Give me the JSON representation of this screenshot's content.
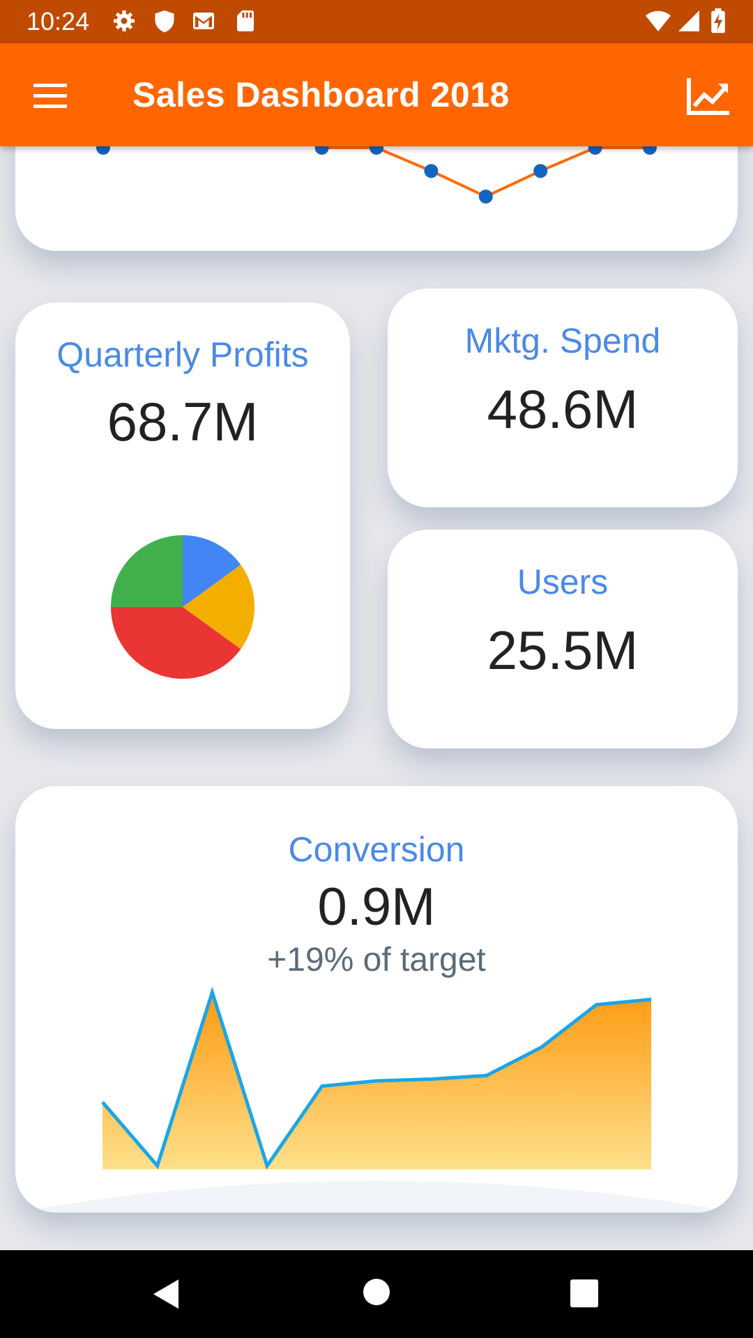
{
  "status_bar": {
    "time": "10:24",
    "left_icons": [
      "settings-icon",
      "shield-icon",
      "gmail-icon",
      "sd-card-icon"
    ],
    "right_icons": [
      "wifi-icon",
      "signal-icon",
      "battery-charging-icon"
    ]
  },
  "app_bar": {
    "title": "Sales Dashboard 2018",
    "menu_icon": "menu-icon",
    "action_icon": "trending-up-icon",
    "color": "#ff6600"
  },
  "top_chart": {
    "type": "line",
    "line_color": "#ff6a00",
    "point_color": "#1565c0",
    "visible_points": [
      {
        "i": 0,
        "v": 100
      },
      {
        "i": 4,
        "v": 100
      },
      {
        "i": 5,
        "v": 100
      },
      {
        "i": 6,
        "v": 80
      },
      {
        "i": 7,
        "v": 58
      },
      {
        "i": 8,
        "v": 80
      },
      {
        "i": 9,
        "v": 100
      },
      {
        "i": 10,
        "v": 100
      }
    ]
  },
  "cards": {
    "profits": {
      "title": "Quarterly Profits",
      "value": "68.7M"
    },
    "mktg": {
      "title": "Mktg. Spend",
      "value": "48.6M"
    },
    "users": {
      "title": "Users",
      "value": "25.5M"
    },
    "conversion": {
      "title": "Conversion",
      "value": "0.9M",
      "subtitle": "+19% of target"
    }
  },
  "chart_data": [
    {
      "type": "pie",
      "slices": [
        {
          "value": 15,
          "color": "#4285f4"
        },
        {
          "value": 20,
          "color": "#f4ae00"
        },
        {
          "value": 40,
          "color": "#ea3535"
        },
        {
          "value": 25,
          "color": "#41b04c"
        }
      ]
    },
    {
      "type": "area",
      "values": [
        38,
        2,
        100,
        2,
        47,
        50,
        51,
        53,
        69,
        93,
        96
      ],
      "line_color": "#1aa6e8",
      "fill_top": "#ff9a12",
      "fill_bottom": "#fde08a"
    }
  ],
  "nav_bar": {
    "buttons": [
      "back-icon",
      "home-icon",
      "recents-icon"
    ]
  }
}
